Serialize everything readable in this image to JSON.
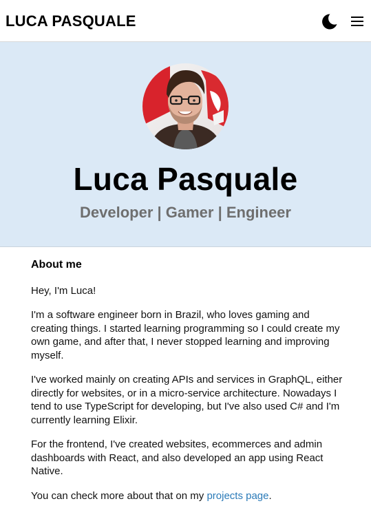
{
  "header": {
    "site_title": "LUCA PASQUALE",
    "theme_icon": "moon-icon",
    "menu_icon": "hamburger-menu-icon"
  },
  "hero": {
    "avatar_alt": "Luca Pasquale",
    "name": "Luca Pasquale",
    "tagline": "Developer | Gamer | Engineer",
    "background_color": "#dbe9f6"
  },
  "about": {
    "heading": "About me",
    "greeting": "Hey, I'm Luca!",
    "paragraph_1": "I'm a software engineer born in Brazil, who loves gaming and creating things. I started learning programming so I could create my own game, and after that, I never stopped learning and improving myself.",
    "paragraph_2": "I've worked mainly on creating APIs and services in GraphQL, either directly for websites, or in a micro-service architecture. Nowadays I tend to use TypeScript for developing, but I've also used C# and I'm currently learning Elixir.",
    "paragraph_3": "For the frontend, I've created websites, ecommerces and admin dashboards with React, and also developed an app using React Native.",
    "paragraph_4_prefix": "You can check more about that on my ",
    "projects_link": "projects page",
    "paragraph_4_suffix": "."
  },
  "colors": {
    "link": "#2a7ab8",
    "tagline": "#6e6e6e"
  }
}
